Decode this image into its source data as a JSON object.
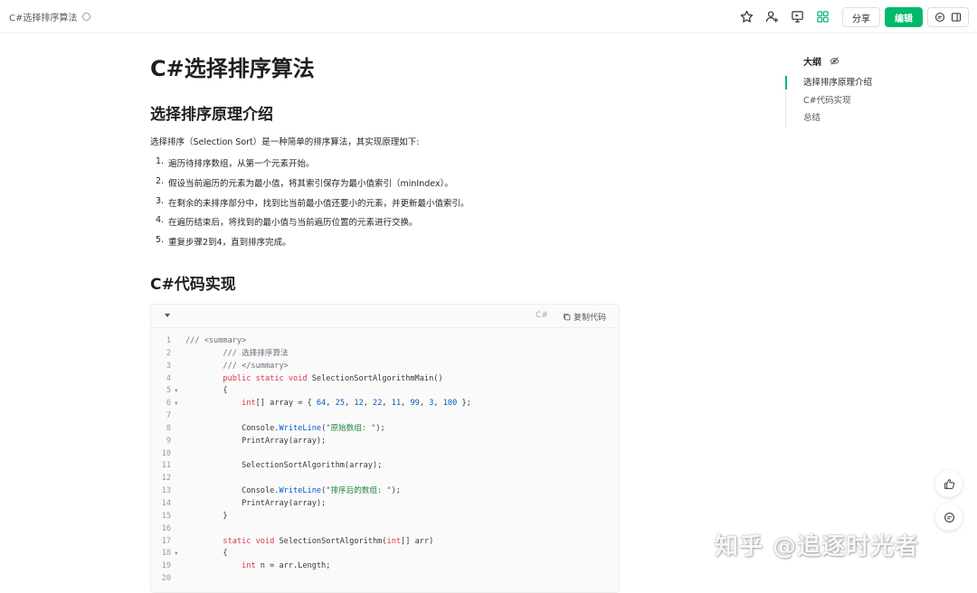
{
  "breadcrumb": {
    "title": "C#选择排序算法"
  },
  "toolbar": {
    "share_label": "分享",
    "edit_label": "编辑",
    "accent": "#00b96b"
  },
  "doc": {
    "title": "C#选择排序算法",
    "section1": "选择排序原理介绍",
    "intro": "选择排序（Selection Sort）是一种简单的排序算法，其实现原理如下:",
    "steps": [
      {
        "num": "1.",
        "text": "遍历待排序数组，从第一个元素开始。"
      },
      {
        "num": "2.",
        "text": "假设当前遍历的元素为最小值，将其索引保存为最小值索引（minIndex）。"
      },
      {
        "num": "3.",
        "text": "在剩余的未排序部分中，找到比当前最小值还要小的元素，并更新最小值索引。"
      },
      {
        "num": "4.",
        "text": "在遍历结束后，将找到的最小值与当前遍历位置的元素进行交换。"
      },
      {
        "num": "5.",
        "text": "重复步骤2到4，直到排序完成。"
      }
    ],
    "section2": "C#代码实现"
  },
  "code": {
    "lang": "C#",
    "copy_label": "复制代码",
    "line_numbers": [
      "1",
      "2",
      "3",
      "4",
      "5",
      "6",
      "7",
      "8",
      "9",
      "10",
      "11",
      "12",
      "13",
      "14",
      "15",
      "16",
      "17",
      "18",
      "19",
      "20"
    ]
  },
  "outline": {
    "title": "大纲",
    "items": [
      "选择排序原理介绍",
      "C#代码实现",
      "总结"
    ]
  },
  "watermark": "知乎 @追逐时光者"
}
